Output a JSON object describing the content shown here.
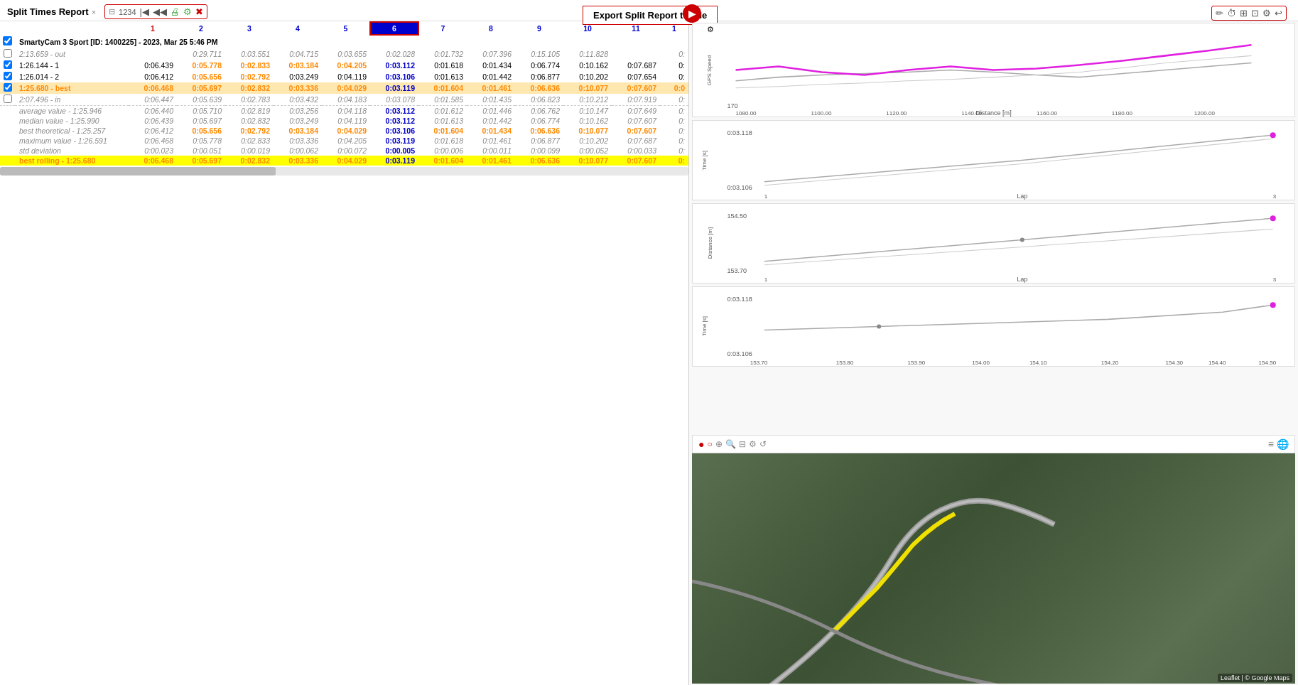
{
  "header": {
    "title": "Split Times Report",
    "close_icon": "×"
  },
  "export_button": {
    "label": "Export Split Report to File"
  },
  "toolbar": {
    "icons": [
      "⊟",
      "1234",
      "|◀",
      "◀◀",
      "🖨",
      "🔧",
      "✖"
    ]
  },
  "right_toolbar": {
    "icons": [
      "✏",
      "⏱",
      "⊞",
      "⊡",
      "⚙",
      "↩"
    ]
  },
  "play_button": "▶",
  "table": {
    "device_header": "SmartyCam 3 Sport [ID: 1400225] - 2023, Mar 25 5:46 PM",
    "columns": [
      "",
      "1",
      "2",
      "3",
      "4",
      "5",
      "6",
      "7",
      "8",
      "9",
      "10",
      "11",
      "1"
    ],
    "selected_col": 6,
    "rows": [
      {
        "type": "out",
        "label": "2:13.659 - out",
        "values": [
          "",
          "0:29.711",
          "0:03.551",
          "0:04.715",
          "0:03.655",
          "0:02.028",
          "0:01.732",
          "0:07.396",
          "0:15.105",
          "0:11.828",
          "0:"
        ]
      },
      {
        "type": "lap1",
        "label": "1:26.144 - 1",
        "values": [
          "0:06.439",
          "0:05.778",
          "0:02.833",
          "0:03.184",
          "0:04.205",
          "0:03.112",
          "0:01.618",
          "0:01.434",
          "0:06.774",
          "0:10.162",
          "0:07.687",
          "0:"
        ]
      },
      {
        "type": "lap2",
        "label": "1:26.014 - 2",
        "values": [
          "0:06.412",
          "0:05.656",
          "0:02.792",
          "0:03.249",
          "0:04.119",
          "0:03.106",
          "0:01.613",
          "0:01.442",
          "0:06.877",
          "0:10.202",
          "0:07.654",
          "0:"
        ]
      },
      {
        "type": "best",
        "label": "1:25.680 - best",
        "values": [
          "0:06.468",
          "0:05.697",
          "0:02.832",
          "0:03.336",
          "0:04.029",
          "0:03.119",
          "0:01.604",
          "0:01.461",
          "0:06.636",
          "0:10.077",
          "0:07.607",
          "0:0"
        ]
      },
      {
        "type": "in",
        "label": "2:07.496 - in",
        "values": [
          "0:06.447",
          "0:05.639",
          "0:02.783",
          "0:03.432",
          "0:04.183",
          "0:03.078",
          "0:01.585",
          "0:01.435",
          "0:06.823",
          "0:10.212",
          "0:07.919",
          "0:"
        ]
      },
      {
        "type": "avg",
        "label": "average value - 1:25.946",
        "values": [
          "0:06.440",
          "0:05.710",
          "0:02.819",
          "0:03.256",
          "0:04.118",
          "0:03.112",
          "0:01.612",
          "0:01.446",
          "0:06.762",
          "0:10.147",
          "0:07.649",
          "0:"
        ]
      },
      {
        "type": "median",
        "label": "median value - 1:25.990",
        "values": [
          "0:06.439",
          "0:05.697",
          "0:02.832",
          "0:03.249",
          "0:04.119",
          "0:03.112",
          "0:01.613",
          "0:01.442",
          "0:06.774",
          "0:10.162",
          "0:07.607",
          "0:"
        ]
      },
      {
        "type": "bestth",
        "label": "best theoretical - 1:25.257",
        "values": [
          "0:06.412",
          "0:05.656",
          "0:02.792",
          "0:03.184",
          "0:04.029",
          "0:03.106",
          "0:01.604",
          "0:01.434",
          "0:06.636",
          "0:10.077",
          "0:07.607",
          "0:"
        ]
      },
      {
        "type": "max",
        "label": "maximum value - 1:26.591",
        "values": [
          "0:06.468",
          "0:05.778",
          "0:02.833",
          "0:03.336",
          "0:04.205",
          "0:03.119",
          "0:01.618",
          "0:01.461",
          "0:06.877",
          "0:10.202",
          "0:07.687",
          "0:"
        ]
      },
      {
        "type": "std",
        "label": "std deviation",
        "values": [
          "0:00.023",
          "0:00.051",
          "0:00.019",
          "0:00.062",
          "0:00.072",
          "0:00.005",
          "0:00.006",
          "0:00.011",
          "0:00.099",
          "0:00.052",
          "0:00.033",
          "0:"
        ]
      },
      {
        "type": "bestroll",
        "label": "best rolling - 1:25.680",
        "values": [
          "0:06.468",
          "0:05.697",
          "0:02.832",
          "0:03.336",
          "0:04.029",
          "0:03.119",
          "0:01.604",
          "0:01.461",
          "0:06.636",
          "0:10.077",
          "0:07.607",
          "0:"
        ]
      }
    ]
  },
  "charts": {
    "chart1": {
      "y_label": "GPS Speed",
      "y_min": "170",
      "y_max": "",
      "x_min": "1080.00",
      "x_max": "1200.00",
      "x_label": "Distance [m]",
      "x_ticks": [
        "1080.00",
        "1100.00",
        "1120.00",
        "1140.00",
        "1160.00",
        "1180.00",
        "1200.00"
      ]
    },
    "chart2": {
      "y_label": "Time [s]",
      "y_min": "0:03.106",
      "y_max": "0:03.118",
      "x_min": "1",
      "x_max": "3",
      "x_label": "Lap"
    },
    "chart3": {
      "y_label": "Distance [m]",
      "y_min": "153.70",
      "y_max": "154.50",
      "x_min": "1",
      "x_max": "3",
      "x_label": "Lap"
    },
    "chart4": {
      "y_label": "Time [s]",
      "y_min": "0:03.106",
      "y_max": "0:03.118",
      "x_min": "153.70",
      "x_max": "154.50",
      "x_label": "Distance [m]"
    }
  },
  "map": {
    "toolbar_icons": [
      "🔴",
      "⚙",
      "🔍",
      "🔍+",
      "🔍-",
      "⚙",
      "↺",
      "≡",
      "🌐"
    ],
    "credit": "Leaflet | © Google Maps"
  }
}
